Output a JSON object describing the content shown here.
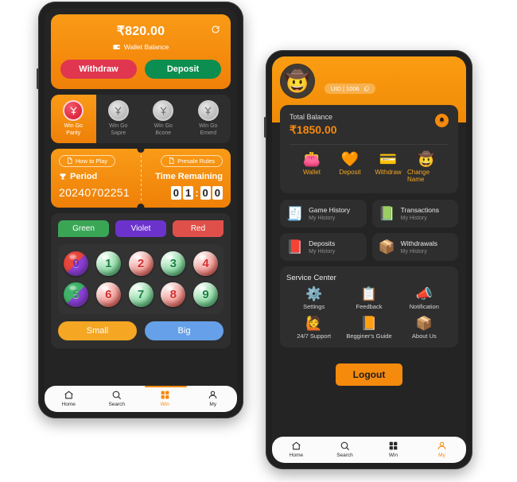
{
  "phone1": {
    "wallet": {
      "amount": "₹820.00",
      "label": "Wallet Balance",
      "refresh_icon": "refresh-icon",
      "wallet_icon": "wallet-icon",
      "withdraw_label": "Withdraw",
      "deposit_label": "Deposit",
      "withdraw_color": "#e0364f",
      "deposit_color": "#0b8e4f",
      "card_color": "#f58a0d"
    },
    "game_tabs": [
      {
        "line1": "Win Go",
        "line2": "Parity",
        "active": true
      },
      {
        "line1": "Win Go",
        "line2": "Sapre",
        "active": false
      },
      {
        "line1": "Win Go",
        "line2": "Bcone",
        "active": false
      },
      {
        "line1": "Win Go",
        "line2": "Emerd",
        "active": false
      }
    ],
    "period": {
      "how_to_play": "How to Play",
      "presale_rules": "Presale Rules",
      "period_label": "Period",
      "period_value": "20240702251",
      "time_label": "Time Remaining",
      "timer": [
        "0",
        "1",
        ":",
        "0",
        "0"
      ]
    },
    "colors": [
      {
        "label": "Green",
        "color": "#3aa655"
      },
      {
        "label": "Violet",
        "color": "#6c33cc"
      },
      {
        "label": "Red",
        "color": "#e0504a"
      }
    ],
    "balls": [
      {
        "n": "0",
        "type": "rv"
      },
      {
        "n": "1",
        "type": "green"
      },
      {
        "n": "2",
        "type": "red"
      },
      {
        "n": "3",
        "type": "green"
      },
      {
        "n": "4",
        "type": "red"
      },
      {
        "n": "5",
        "type": "gv"
      },
      {
        "n": "6",
        "type": "red"
      },
      {
        "n": "7",
        "type": "green"
      },
      {
        "n": "8",
        "type": "red"
      },
      {
        "n": "9",
        "type": "green"
      }
    ],
    "size_bets": [
      {
        "label": "Small",
        "color": "#f5a623"
      },
      {
        "label": "Big",
        "color": "#66a0e8"
      }
    ],
    "bottom_nav": [
      {
        "label": "Home",
        "icon": "home-icon",
        "active": false
      },
      {
        "label": "Search",
        "icon": "search-icon",
        "active": false
      },
      {
        "label": "Win",
        "icon": "grid-icon",
        "active": true
      },
      {
        "label": "My",
        "icon": "person-icon",
        "active": false
      }
    ]
  },
  "phone2": {
    "header": {
      "avatar_icon": "avatar-cowboy-icon",
      "uid_text": "UID | 1006",
      "copy_icon": "copy-icon"
    },
    "balance": {
      "label": "Total Balance",
      "amount": "₹1850.00",
      "bell_icon": "bell-icon",
      "accent": "#f58a0d"
    },
    "quick_actions": [
      {
        "label": "Wallet",
        "icon": "wallet-icon"
      },
      {
        "label": "Deposit",
        "icon": "deposit-icon"
      },
      {
        "label": "Withdraw",
        "icon": "withdraw-card-icon"
      },
      {
        "label": "Change Name",
        "icon": "change-name-icon"
      }
    ],
    "history_cards": [
      {
        "title": "Game History",
        "sub": "My History",
        "icon": "game-history-icon"
      },
      {
        "title": "Transactions",
        "sub": "My History",
        "icon": "transactions-icon"
      },
      {
        "title": "Deposits",
        "sub": "My History",
        "icon": "deposits-icon"
      },
      {
        "title": "Withdrawals",
        "sub": "My History",
        "icon": "withdrawals-icon"
      }
    ],
    "service_center": {
      "title": "Service Center",
      "items": [
        {
          "label": "Settings",
          "icon": "gear-icon"
        },
        {
          "label": "Feedback",
          "icon": "clipboard-icon"
        },
        {
          "label": "Notification",
          "icon": "megaphone-icon"
        },
        {
          "label": "24/7 Support",
          "icon": "support-agent-icon"
        },
        {
          "label": "Begginer's Guide",
          "icon": "book-icon"
        },
        {
          "label": "About Us",
          "icon": "box-icon"
        }
      ]
    },
    "logout_label": "Logout",
    "bottom_nav": [
      {
        "label": "Home",
        "icon": "home-icon",
        "active": false
      },
      {
        "label": "Search",
        "icon": "search-icon",
        "active": false
      },
      {
        "label": "Win",
        "icon": "grid-icon",
        "active": false
      },
      {
        "label": "My",
        "icon": "person-icon",
        "active": true
      }
    ]
  }
}
